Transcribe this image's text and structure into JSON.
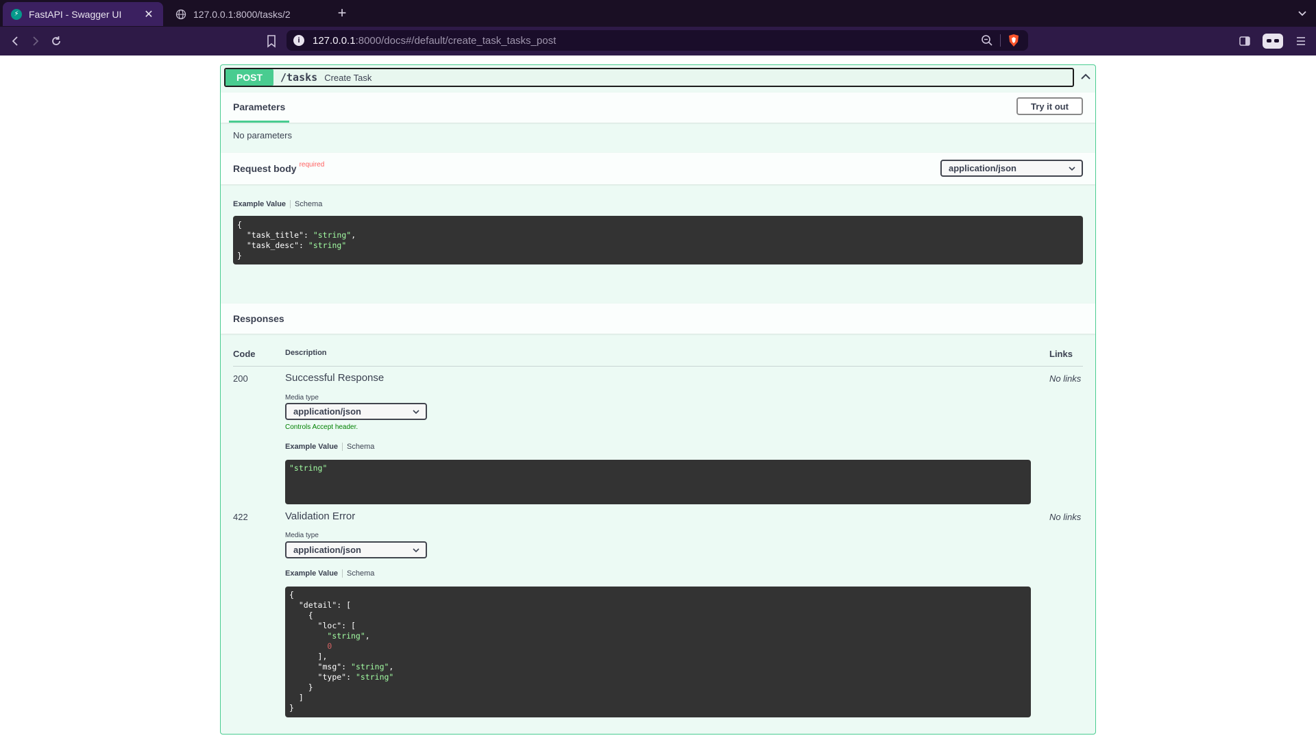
{
  "browser": {
    "tabs": [
      {
        "title": "FastAPI - Swagger UI",
        "active": true
      },
      {
        "title": "127.0.0.1:8000/tasks/2",
        "active": false
      }
    ],
    "url_host": "127.0.0.1",
    "url_rest": ":8000/docs#/default/create_task_tasks_post"
  },
  "operation": {
    "method": "POST",
    "path": "/tasks",
    "summary": "Create Task",
    "parameters_tab": "Parameters",
    "try_it_out": "Try it out",
    "no_parameters": "No parameters",
    "request_body_title": "Request body",
    "required_label": "required",
    "request_content_type": "application/json",
    "example_value_tab": "Example Value",
    "schema_tab": "Schema",
    "request_example": {
      "task_title": "string",
      "task_desc": "string"
    }
  },
  "responses": {
    "title": "Responses",
    "headers": {
      "code": "Code",
      "description": "Description",
      "links": "Links"
    },
    "items": [
      {
        "code": "200",
        "description": "Successful Response",
        "links": "No links",
        "media_type_label": "Media type",
        "media_type": "application/json",
        "controls_accept": "Controls Accept header.",
        "example_value_tab": "Example Value",
        "schema_tab": "Schema",
        "example": "\"string\""
      },
      {
        "code": "422",
        "description": "Validation Error",
        "links": "No links",
        "media_type_label": "Media type",
        "media_type": "application/json",
        "example_value_tab": "Example Value",
        "schema_tab": "Schema"
      }
    ]
  },
  "colors": {
    "post_accent": "#49cc90",
    "code_bg": "#333333",
    "string_green": "#a2fca2",
    "number_red": "#d36363"
  }
}
